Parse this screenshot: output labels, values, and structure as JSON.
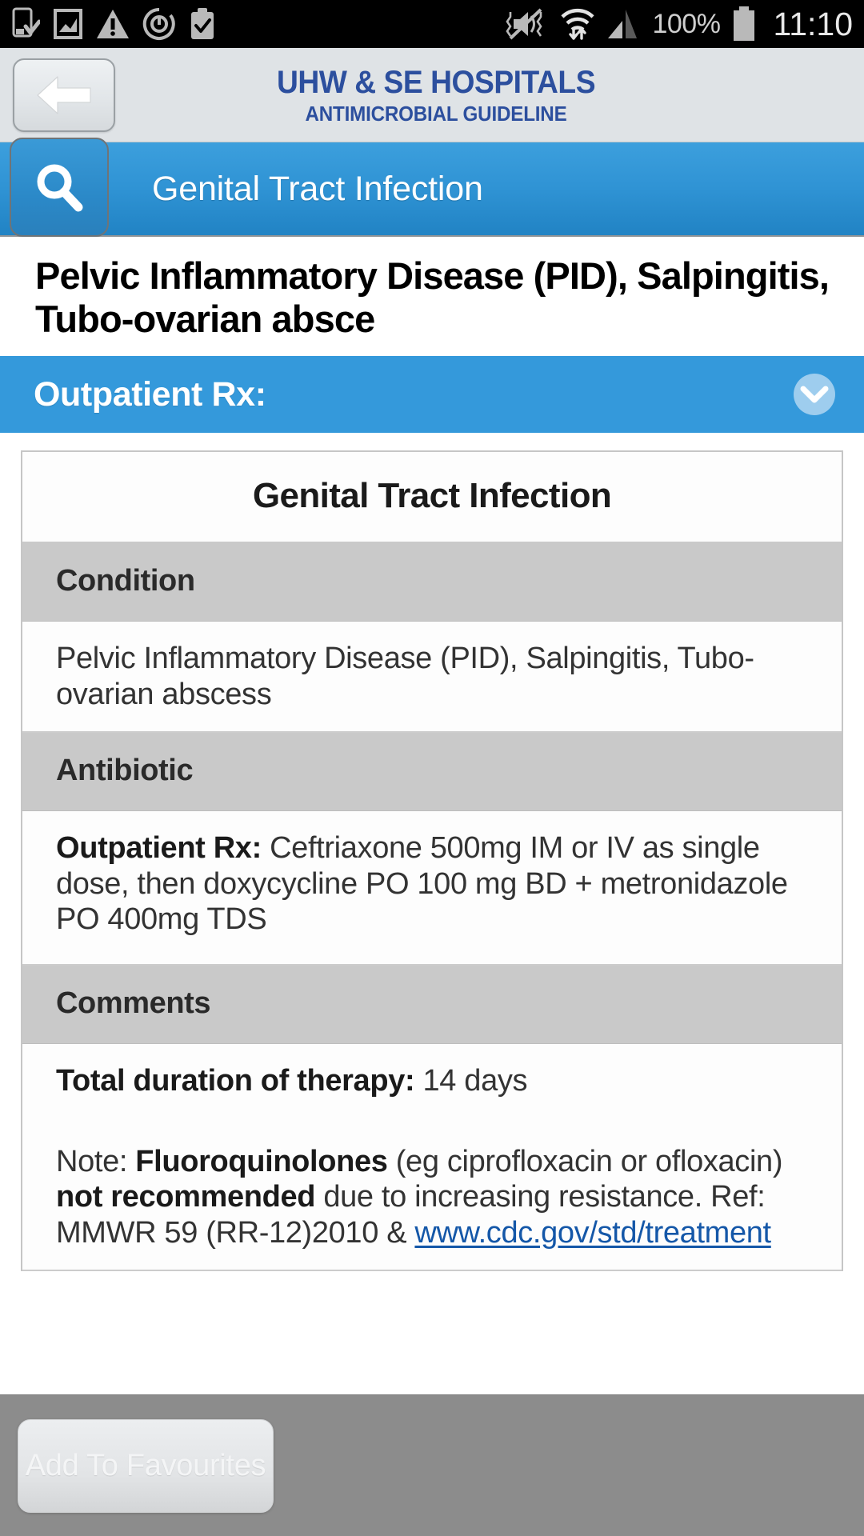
{
  "status_bar": {
    "icons_left": [
      "phone-download-icon",
      "image-chart-icon",
      "warning-triangle-icon",
      "power-sync-icon",
      "clipboard-check-icon"
    ],
    "icons_right": [
      "mute-vibrate-icon",
      "wifi-transfer-icon",
      "signal-bars-icon",
      "battery-icon"
    ],
    "battery_percent": "100%",
    "time": "11:10"
  },
  "header": {
    "back_button": "back-arrow-icon",
    "brand_main": "UHW & SE HOSPITALS",
    "brand_sub": "ANTIMICROBIAL GUIDELINE",
    "brand_color": "#2c4f9e"
  },
  "search_bar": {
    "icon": "search-icon",
    "category_label": "Genital Tract Infection",
    "accent_color": "#2f93d4"
  },
  "page_title": "Pelvic Inflammatory Disease (PID), Salpingitis, Tubo-ovarian absce",
  "section": {
    "label": "Outpatient Rx:",
    "expand_icon": "chevron-down-circle-icon",
    "background_color": "#3499db"
  },
  "table": {
    "title": "Genital Tract Infection",
    "rows": [
      {
        "header": "Condition",
        "value": "Pelvic Inflammatory Disease (PID), Salpingitis, Tubo-ovarian abscess"
      },
      {
        "header": "Antibiotic",
        "value_label": "Outpatient Rx:",
        "value": " Ceftriaxone 500mg IM or IV as single dose, then doxycycline PO 100 mg BD + metronidazole PO 400mg TDS"
      },
      {
        "header": "Comments",
        "duration_label": "Total duration of therapy:",
        "duration_value": " 14 days",
        "note_prefix": "Note: ",
        "note_bold_1": "Fluoroquinolones",
        "note_mid_1": " (eg ciprofloxacin or ofloxacin) ",
        "note_bold_2": "not recommended",
        "note_mid_2": " due to increasing resistance. Ref: MMWR 59 (RR-12)2010 & ",
        "note_link": "www.cdc.gov/std/treatment"
      }
    ]
  },
  "bottom_bar": {
    "favourites_button": "Add To Favourites",
    "background_color": "#8c8c8c"
  }
}
